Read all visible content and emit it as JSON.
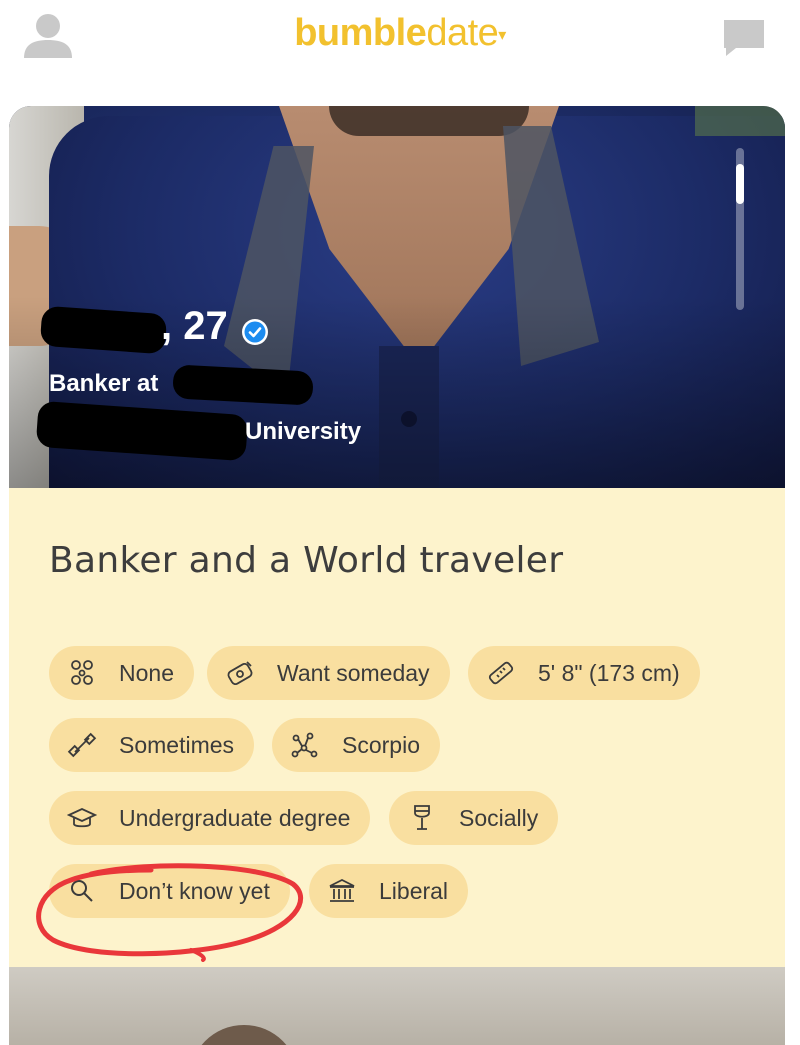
{
  "header": {
    "logo_bold": "bumble",
    "logo_light": "date",
    "logo_caret": "▾"
  },
  "profile": {
    "name_age": ", 27",
    "job": "Banker at",
    "school": "University",
    "headline": "Banker and a World traveler"
  },
  "chips": [
    {
      "icon": "kids-icon",
      "label": "None"
    },
    {
      "icon": "pacifier-icon",
      "label": "Want someday"
    },
    {
      "icon": "ruler-icon",
      "label": "5' 8\" (173 cm)"
    },
    {
      "icon": "dumbbell-icon",
      "label": "Sometimes"
    },
    {
      "icon": "zodiac-icon",
      "label": "Scorpio"
    },
    {
      "icon": "graduation-cap-icon",
      "label": "Undergraduate degree"
    },
    {
      "icon": "wine-glass-icon",
      "label": "Socially"
    },
    {
      "icon": "search-icon",
      "label": "Don’t know yet"
    },
    {
      "icon": "government-building-icon",
      "label": "Liberal"
    }
  ],
  "colors": {
    "brand": "#f2c12e",
    "chip_bg": "#f9dfa0",
    "section_bg": "#fdf3cc",
    "annotation": "#e9373a",
    "verified": "#1d8cf0"
  }
}
